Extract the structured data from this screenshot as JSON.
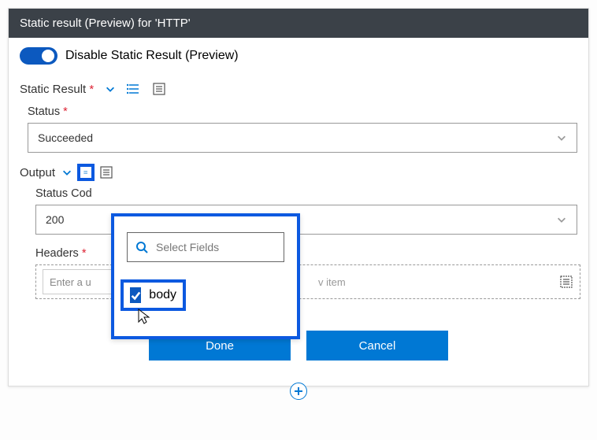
{
  "header": {
    "title": "Static result (Preview) for 'HTTP'"
  },
  "toggle": {
    "label": "Disable Static Result (Preview)"
  },
  "staticResult": {
    "label": "Static Result",
    "required": "*"
  },
  "status": {
    "label": "Status",
    "required": "*",
    "value": "Succeeded"
  },
  "output": {
    "label": "Output"
  },
  "statusCode": {
    "label": "Status Cod",
    "value": "200"
  },
  "headers": {
    "label": "Headers",
    "required": "*",
    "placeholder": "Enter a u",
    "sidetext": "v item"
  },
  "dropdown": {
    "searchPlaceholder": "Select Fields",
    "option1": "body"
  },
  "buttons": {
    "done": "Done",
    "cancel": "Cancel"
  }
}
